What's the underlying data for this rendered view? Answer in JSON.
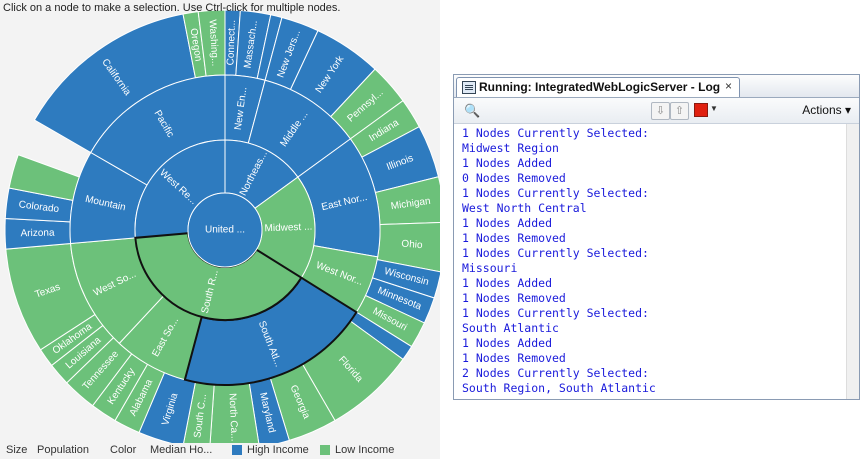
{
  "instructions": "Click on a node to make a selection. Use Ctrl-click for multiple nodes.",
  "colors": {
    "high": "#2e7bbf",
    "low": "#6cc17a",
    "panel_bg": "#f3f3f3",
    "log_text": "#1a1adb"
  },
  "sunburst": {
    "root": {
      "label": "United ...",
      "color": "high"
    },
    "regions": [
      {
        "label": "Northeas...",
        "color": "high",
        "start": 0,
        "end": 54
      },
      {
        "label": "Midwest ...",
        "color": "low",
        "start": 54,
        "end": 122
      },
      {
        "label": "South R...",
        "color": "low",
        "start": 122,
        "end": 265,
        "selected": true
      },
      {
        "label": "West Re...",
        "color": "high",
        "start": 265,
        "end": 360
      }
    ],
    "divisions": [
      {
        "label": "New En...",
        "color": "high",
        "start": 0,
        "end": 15
      },
      {
        "label": "Middle ...",
        "color": "high",
        "start": 15,
        "end": 54
      },
      {
        "label": "East Nor...",
        "color": "high",
        "start": 54,
        "end": 100
      },
      {
        "label": "West Nor...",
        "color": "low",
        "start": 100,
        "end": 122
      },
      {
        "label": "South Atl...",
        "color": "high",
        "start": 122,
        "end": 195,
        "selected": true
      },
      {
        "label": "East So...",
        "color": "low",
        "start": 195,
        "end": 223
      },
      {
        "label": "West So...",
        "color": "low",
        "start": 223,
        "end": 265
      },
      {
        "label": "Mountain",
        "color": "high",
        "start": 265,
        "end": 300
      },
      {
        "label": "Pacific",
        "color": "high",
        "start": 300,
        "end": 360
      }
    ],
    "states": [
      {
        "label": "Connect...",
        "color": "high",
        "start": 0,
        "end": 4
      },
      {
        "label": "Massach...",
        "color": "high",
        "start": 4,
        "end": 12
      },
      {
        "label": "",
        "color": "high",
        "start": 12,
        "end": 15
      },
      {
        "label": "New Jers...",
        "color": "high",
        "start": 15,
        "end": 25
      },
      {
        "label": "New York",
        "color": "high",
        "start": 25,
        "end": 43
      },
      {
        "label": "Pennsyl...",
        "color": "low",
        "start": 43,
        "end": 54
      },
      {
        "label": "Indiana",
        "color": "low",
        "start": 54,
        "end": 62
      },
      {
        "label": "Illinois",
        "color": "high",
        "start": 62,
        "end": 76
      },
      {
        "label": "Michigan",
        "color": "low",
        "start": 76,
        "end": 88
      },
      {
        "label": "Ohio",
        "color": "low",
        "start": 88,
        "end": 101
      },
      {
        "label": "Wisconsin",
        "color": "high",
        "start": 101,
        "end": 108
      },
      {
        "label": "Minnesota",
        "color": "high",
        "start": 108,
        "end": 115
      },
      {
        "label": "Missouri",
        "color": "low",
        "start": 115,
        "end": 122
      },
      {
        "label": "",
        "color": "high",
        "start": 122,
        "end": 126
      },
      {
        "label": "Florida",
        "color": "low",
        "start": 126,
        "end": 150
      },
      {
        "label": "Georgia",
        "color": "low",
        "start": 150,
        "end": 163
      },
      {
        "label": "Maryland",
        "color": "high",
        "start": 163,
        "end": 171
      },
      {
        "label": "North Ca...",
        "color": "low",
        "start": 171,
        "end": 184
      },
      {
        "label": "South C...",
        "color": "low",
        "start": 184,
        "end": 191
      },
      {
        "label": "Virginia",
        "color": "high",
        "start": 191,
        "end": 203
      },
      {
        "label": "Alabama",
        "color": "low",
        "start": 203,
        "end": 210
      },
      {
        "label": "Kentucky",
        "color": "low",
        "start": 210,
        "end": 217
      },
      {
        "label": "Tennessee",
        "color": "low",
        "start": 217,
        "end": 226
      },
      {
        "label": "Louisiana",
        "color": "low",
        "start": 226,
        "end": 232
      },
      {
        "label": "Oklahoma",
        "color": "low",
        "start": 232,
        "end": 237
      },
      {
        "label": "Texas",
        "color": "low",
        "start": 237,
        "end": 265
      },
      {
        "label": "Arizona",
        "color": "high",
        "start": 265,
        "end": 273
      },
      {
        "label": "Colorado",
        "color": "high",
        "start": 273,
        "end": 281
      },
      {
        "label": "",
        "color": "low",
        "start": 281,
        "end": 290
      },
      {
        "label": "California",
        "color": "high",
        "start": 300,
        "end": 349
      },
      {
        "label": "Oregon",
        "color": "low",
        "start": 349,
        "end": 353
      },
      {
        "label": "Washing...",
        "color": "low",
        "start": 353,
        "end": 360
      }
    ]
  },
  "legend": {
    "size_label": "Size",
    "size_value": "Population",
    "color_label": "Color",
    "color_value": "Median Ho...",
    "high_label": "High Income",
    "low_label": "Low Income"
  },
  "log_window": {
    "tab_title": "Running: IntegratedWebLogicServer - Log",
    "close": "×",
    "actions_label": "Actions ▾",
    "lines": [
      "1 Nodes Currently Selected:",
      "Midwest Region",
      "1 Nodes Added",
      "0 Nodes Removed",
      "1 Nodes Currently Selected:",
      "West North Central",
      "1 Nodes Added",
      "1 Nodes Removed",
      "1 Nodes Currently Selected:",
      "Missouri",
      "1 Nodes Added",
      "1 Nodes Removed",
      "1 Nodes Currently Selected:",
      "South Atlantic",
      "1 Nodes Added",
      "1 Nodes Removed",
      "2 Nodes Currently Selected:",
      "South Region, South Atlantic"
    ]
  }
}
